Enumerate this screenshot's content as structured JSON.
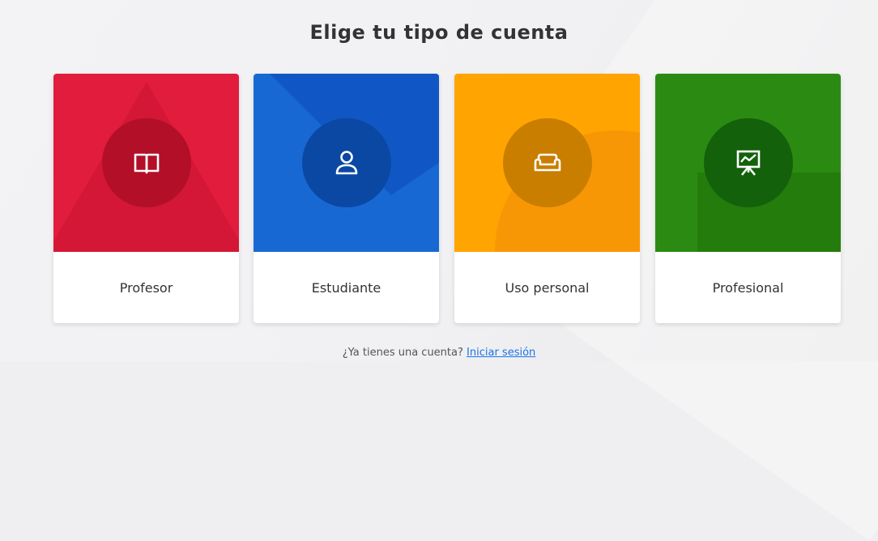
{
  "title": "Elige tu tipo de cuenta",
  "cards": [
    {
      "label": "Profesor",
      "icon": "book-icon",
      "color": "#e21c3d",
      "circle": "#b30f28"
    },
    {
      "label": "Estudiante",
      "icon": "person-icon",
      "color": "#1868d4",
      "circle": "#0a48a4"
    },
    {
      "label": "Uso personal",
      "icon": "sofa-icon",
      "color": "#ffa400",
      "circle": "#c97e00"
    },
    {
      "label": "Profesional",
      "icon": "presentation-board-icon",
      "color": "#2b8a12",
      "circle": "#13610a"
    }
  ],
  "footer": {
    "prompt": "¿Ya tienes una cuenta?",
    "link": "Iniciar sesión"
  }
}
